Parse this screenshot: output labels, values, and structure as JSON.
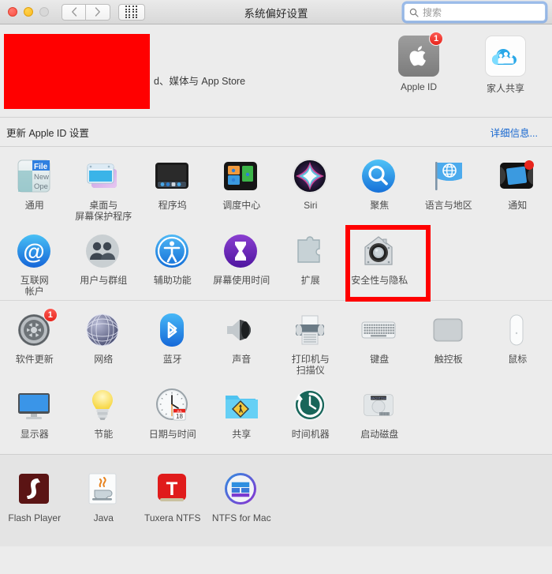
{
  "window": {
    "title": "系统偏好设置",
    "traffic_lights": [
      "close",
      "minimize",
      "zoom"
    ],
    "nav_back": "‹",
    "nav_forward": "›",
    "grid_button": "show-all"
  },
  "search": {
    "placeholder": "搜索",
    "value": "",
    "icon": "search-icon"
  },
  "banner": {
    "redacted": true,
    "text": "d、媒体与 App Store",
    "icons": [
      {
        "label": "Apple ID",
        "icon": "apple-logo-icon",
        "badge": "1"
      },
      {
        "label": "家人共享",
        "icon": "family-sharing-icon",
        "badge": ""
      }
    ]
  },
  "update_row": {
    "text": "更新 Apple ID 设置",
    "link": "详细信息..."
  },
  "main_grid": [
    {
      "label": "通用",
      "icon": "general-icon",
      "badge": "",
      "selected": false
    },
    {
      "label": "桌面与\n屏幕保护程序",
      "icon": "desktop-screensaver-icon",
      "badge": "",
      "selected": false
    },
    {
      "label": "程序坞",
      "icon": "dock-icon",
      "badge": "",
      "selected": false
    },
    {
      "label": "调度中心",
      "icon": "mission-control-icon",
      "badge": "",
      "selected": false
    },
    {
      "label": "Siri",
      "icon": "siri-icon",
      "badge": "",
      "selected": false
    },
    {
      "label": "聚焦",
      "icon": "spotlight-icon",
      "badge": "",
      "selected": false
    },
    {
      "label": "语言与地区",
      "icon": "language-region-icon",
      "badge": "",
      "selected": false
    },
    {
      "label": "通知",
      "icon": "notifications-icon",
      "badge": "",
      "selected": false
    },
    {
      "label": "互联网\n帐户",
      "icon": "internet-accounts-icon",
      "badge": "",
      "selected": false
    },
    {
      "label": "用户与群组",
      "icon": "users-groups-icon",
      "badge": "",
      "selected": false
    },
    {
      "label": "辅助功能",
      "icon": "accessibility-icon",
      "badge": "",
      "selected": false
    },
    {
      "label": "屏幕使用时间",
      "icon": "screen-time-icon",
      "badge": "",
      "selected": false
    },
    {
      "label": "扩展",
      "icon": "extensions-icon",
      "badge": "",
      "selected": false
    },
    {
      "label": "安全性与隐私",
      "icon": "security-privacy-icon",
      "badge": "",
      "selected": true
    }
  ],
  "hardware_grid": [
    {
      "label": "软件更新",
      "icon": "software-update-icon",
      "badge": "1"
    },
    {
      "label": "网络",
      "icon": "network-icon",
      "badge": ""
    },
    {
      "label": "蓝牙",
      "icon": "bluetooth-icon",
      "badge": ""
    },
    {
      "label": "声音",
      "icon": "sound-icon",
      "badge": ""
    },
    {
      "label": "打印机与\n扫描仪",
      "icon": "printers-scanners-icon",
      "badge": ""
    },
    {
      "label": "键盘",
      "icon": "keyboard-icon",
      "badge": ""
    },
    {
      "label": "触控板",
      "icon": "trackpad-icon",
      "badge": ""
    },
    {
      "label": "鼠标",
      "icon": "mouse-icon",
      "badge": ""
    },
    {
      "label": "显示器",
      "icon": "displays-icon",
      "badge": ""
    },
    {
      "label": "节能",
      "icon": "energy-saver-icon",
      "badge": ""
    },
    {
      "label": "日期与时间",
      "icon": "date-time-icon",
      "badge": ""
    },
    {
      "label": "共享",
      "icon": "sharing-icon",
      "badge": ""
    },
    {
      "label": "时间机器",
      "icon": "time-machine-icon",
      "badge": ""
    },
    {
      "label": "启动磁盘",
      "icon": "startup-disk-icon",
      "badge": ""
    }
  ],
  "third_party_grid": [
    {
      "label": "Flash Player",
      "icon": "flash-player-icon"
    },
    {
      "label": "Java",
      "icon": "java-icon"
    },
    {
      "label": "Tuxera NTFS",
      "icon": "tuxera-ntfs-icon"
    },
    {
      "label": "NTFS for Mac",
      "icon": "ntfs-for-mac-icon"
    }
  ],
  "colors": {
    "window_bg": "#ececec",
    "bottom_bg": "#e4e4e4",
    "highlight": "#ff0000",
    "link": "#1868d0",
    "badge": "#e8241c",
    "titlebar": "#d8d8d8"
  },
  "icon_glyphs": {
    "general-icon": "File",
    "dock-icon": "▦",
    "siri-icon": "✳",
    "spotlight-icon": "Q",
    "notifications-icon": "▤",
    "internet-accounts-icon": "@",
    "users-groups-icon": "👥",
    "accessibility-icon": "♿",
    "screen-time-icon": "⧖",
    "extensions-icon": "🧩",
    "security-privacy-icon": "⌂",
    "software-update-icon": "⚙",
    "network-icon": "🌐",
    "bluetooth-icon": "ᛒ",
    "sound-icon": "🔊",
    "keyboard-icon": "⌨",
    "mouse-icon": "🖱",
    "displays-icon": "🖥",
    "energy-saver-icon": "💡",
    "date-time-icon": "🕐",
    "sharing-icon": "📁",
    "time-machine-icon": "⟲",
    "startup-disk-icon": "💽",
    "flash-player-icon": "f",
    "java-icon": "☕",
    "tuxera-ntfs-icon": "T",
    "ntfs-for-mac-icon": "▤"
  }
}
